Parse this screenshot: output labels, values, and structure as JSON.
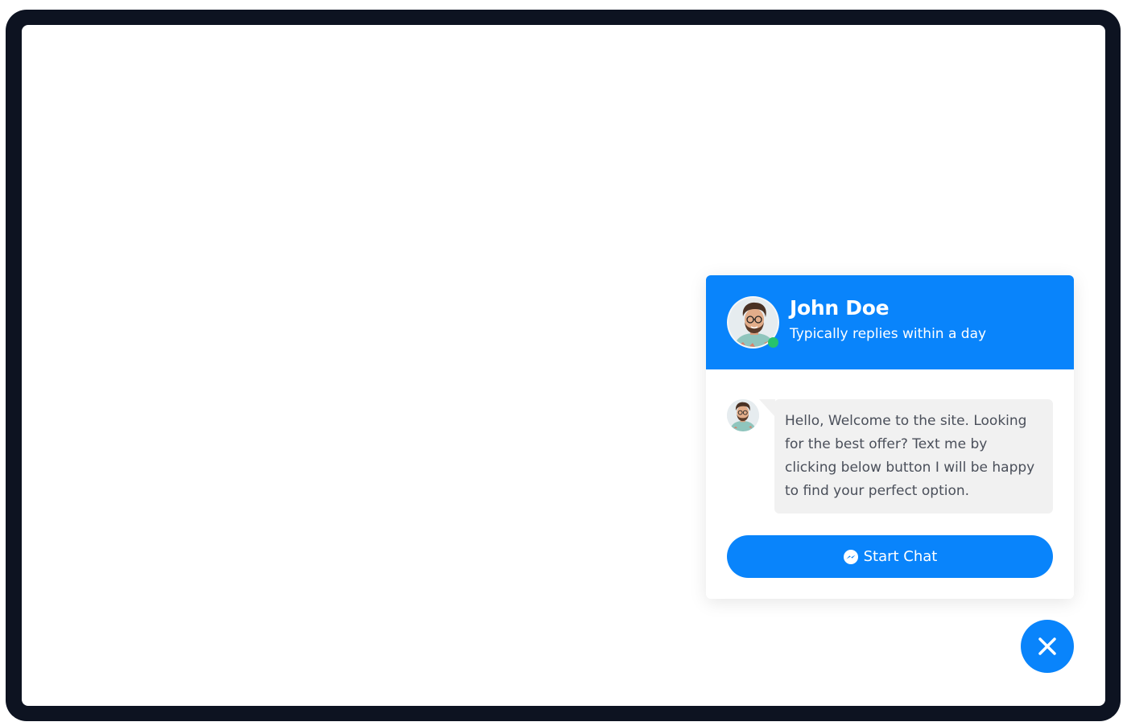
{
  "colors": {
    "frame": "#0d1321",
    "accent": "#0984fb",
    "online": "#27c36e",
    "bubble_bg": "#f1f1f1",
    "bubble_text": "#4a4f5a"
  },
  "widget": {
    "agent_name": "John Doe",
    "agent_status": "Typically replies within a day",
    "avatar_icon": "user-avatar-photo",
    "online_indicator": "online-status-dot",
    "message": "Hello, Welcome to the site. Looking for the best offer? Text me by clicking below button I will be happy to find your perfect option.",
    "start_chat_label": "Start Chat",
    "start_chat_icon": "messenger-icon"
  },
  "close_button": {
    "icon": "close-icon"
  }
}
